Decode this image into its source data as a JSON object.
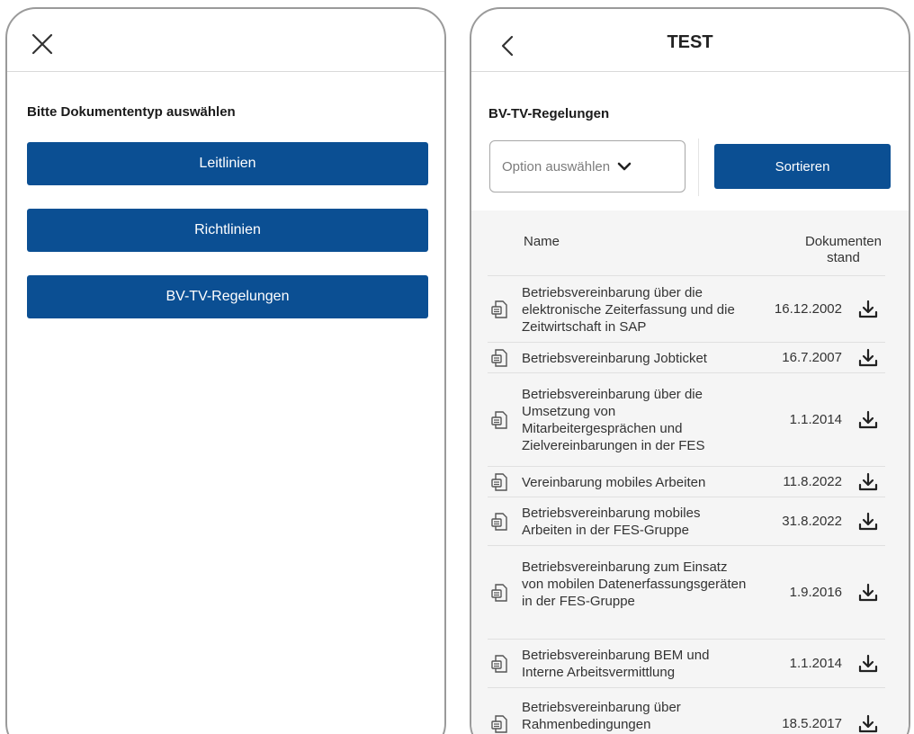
{
  "left": {
    "prompt": "Bitte Dokumententyp auswählen",
    "buttons": [
      "Leitlinien",
      "Richtlinien",
      "BV-TV-Regelungen"
    ]
  },
  "right": {
    "title": "TEST",
    "section": "BV-TV-Regelungen",
    "select_placeholder": "Option auswählen",
    "sort_label": "Sortieren",
    "col_name": "Name",
    "col_date_line1": "Dokumenten",
    "col_date_line2": "stand",
    "rows": [
      {
        "name": "Betriebsvereinbarung über die elektronische Zeiterfassung und die Zeitwirtschaft in SAP",
        "date": "16.12.2002"
      },
      {
        "name": "Betriebsvereinbarung Jobticket",
        "date": "16.7.2007"
      },
      {
        "name": "Betriebsvereinbarung über die Umsetzung von Mitarbeitergesprächen und Zielvereinbarungen in der FES",
        "date": "1.1.2014"
      },
      {
        "name": "Vereinbarung mobiles Arbeiten",
        "date": "11.8.2022"
      },
      {
        "name": "Betriebsvereinbarung mobiles Arbeiten in der FES-Gruppe",
        "date": "31.8.2022"
      },
      {
        "name": "Betriebsvereinbarung zum Einsatz von mobilen Datenerfassungsgeräten in der FES-Gruppe",
        "date": "1.9.2016"
      },
      {
        "name": "Betriebsvereinbarung BEM und Interne Arbeitsvermittlung",
        "date": "1.1.2014"
      },
      {
        "name": "Betriebsvereinbarung über Rahmenbedingungen",
        "date": "18.5.2017"
      }
    ]
  },
  "colors": {
    "primary": "#0b4f93",
    "table_bg": "#f5f5f5",
    "border": "#9a9a9a"
  }
}
